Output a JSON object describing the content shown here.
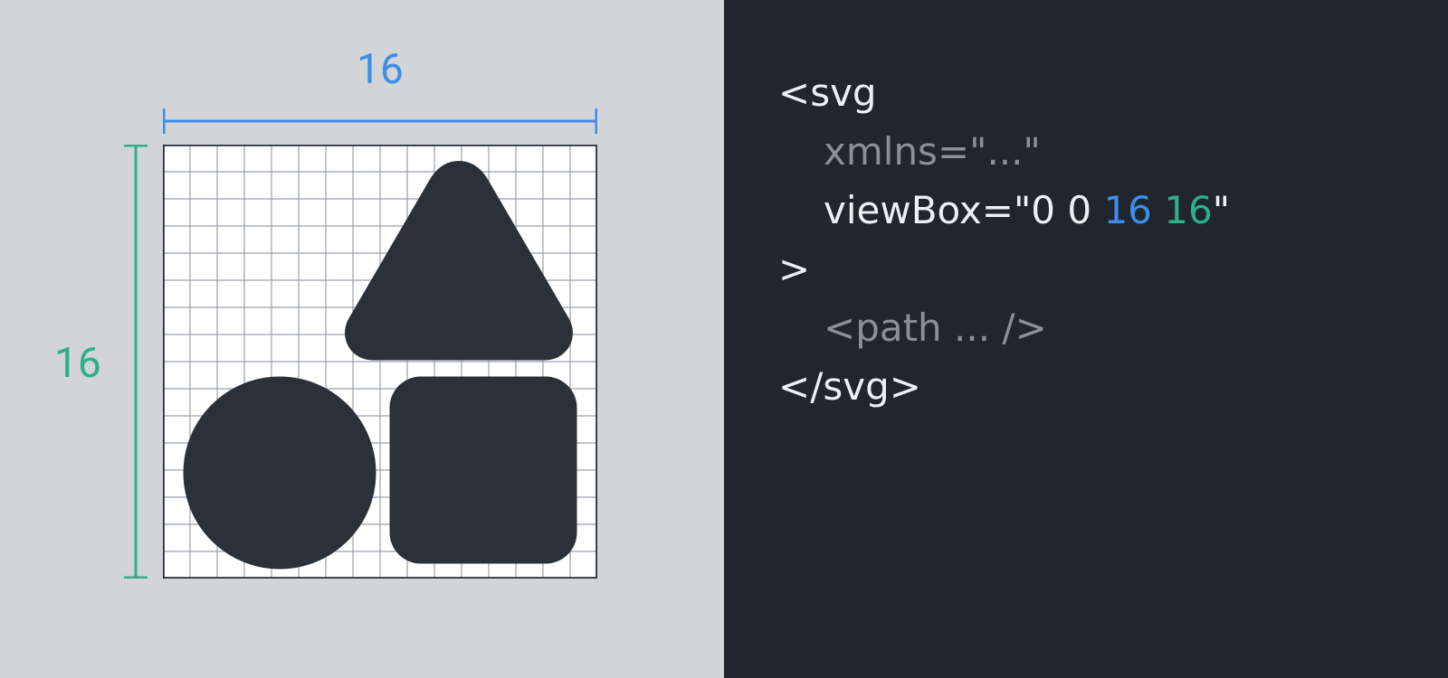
{
  "diagram": {
    "width_label": "16",
    "height_label": "16",
    "grid_cells": 16,
    "colors": {
      "width_dim": "#3b8eea",
      "height_dim": "#2bb08a",
      "shape_fill": "#2c3039",
      "grid_line": "#9aa0ab",
      "grid_bg": "#ffffff",
      "left_bg": "#d2d4d8",
      "right_bg": "#21252d"
    }
  },
  "code": {
    "open_tag": "<svg",
    "xmlns_attr": "xmlns=\"...\"",
    "viewbox_prefix": "viewBox=\"0 0 ",
    "viewbox_w": "16",
    "viewbox_sep": " ",
    "viewbox_h": "16",
    "viewbox_suffix": "\"",
    "open_close": ">",
    "path_line": "<path ... />",
    "close_tag": "</svg>"
  }
}
